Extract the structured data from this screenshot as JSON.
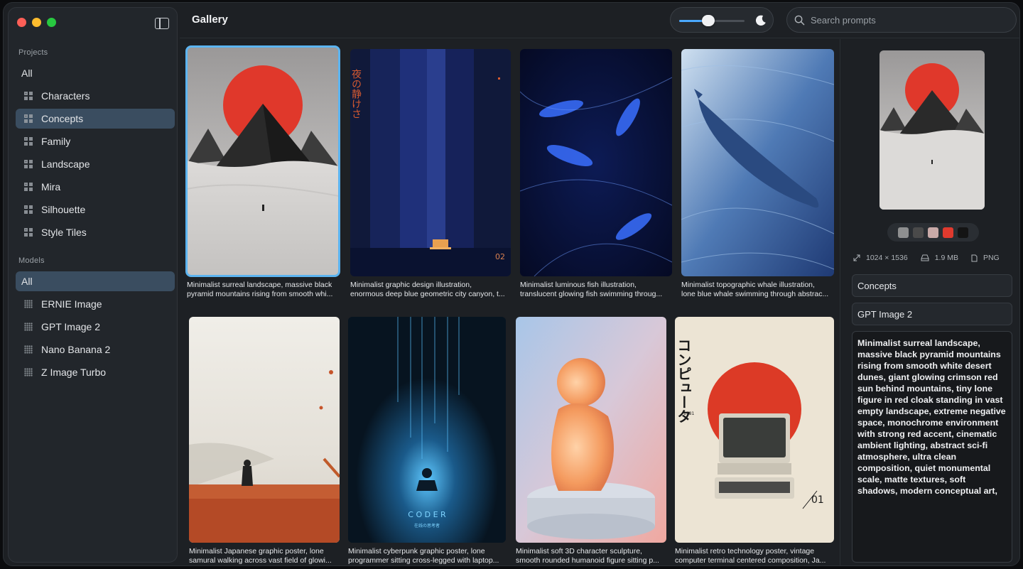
{
  "header": {
    "title": "Gallery",
    "zoom_value": 0.45,
    "search_placeholder": "Search prompts"
  },
  "sidebar": {
    "projects_label": "Projects",
    "projects": [
      {
        "label": "All",
        "icon": "none"
      },
      {
        "label": "Characters",
        "icon": "grid-icon"
      },
      {
        "label": "Concepts",
        "icon": "grid-icon",
        "active": true
      },
      {
        "label": "Family",
        "icon": "grid-icon"
      },
      {
        "label": "Landscape",
        "icon": "grid-icon"
      },
      {
        "label": "Mira",
        "icon": "grid-icon"
      },
      {
        "label": "Silhouette",
        "icon": "grid-icon"
      },
      {
        "label": "Style Tiles",
        "icon": "grid-icon"
      }
    ],
    "models_label": "Models",
    "models": [
      {
        "label": "All",
        "icon": "none",
        "active": true
      },
      {
        "label": "ERNIE Image",
        "icon": "dots-icon"
      },
      {
        "label": "GPT Image 2",
        "icon": "dots-icon"
      },
      {
        "label": "Nano Banana 2",
        "icon": "dots-icon"
      },
      {
        "label": "Z Image Turbo",
        "icon": "dots-icon"
      }
    ]
  },
  "gallery": {
    "items": [
      {
        "caption1": "Minimalist surreal landscape, massive black",
        "caption2": "pyramid mountains rising from smooth whi...",
        "selected": true
      },
      {
        "caption1": "Minimalist graphic design illustration,",
        "caption2": "enormous deep blue geometric city canyon, t..."
      },
      {
        "caption1": "Minimalist luminous fish illustration,",
        "caption2": "translucent glowing fish swimming throug..."
      },
      {
        "caption1": "Minimalist topographic whale illustration,",
        "caption2": "lone blue whale swimming through abstrac..."
      },
      {
        "caption1": "Minimalist Japanese graphic poster, lone",
        "caption2": "samural walking across vast field of glowi..."
      },
      {
        "caption1": "Minimalist cyberpunk graphic poster, lone",
        "caption2": "programmer sitting cross-legged with laptop..."
      },
      {
        "caption1": "Minimalist soft 3D character sculpture,",
        "caption2": "smooth rounded humanoid figure sitting p..."
      },
      {
        "caption1": "Minimalist retro technology poster, vintage",
        "caption2": "computer terminal centered composition, Ja..."
      }
    ],
    "poster_text": {
      "city_vertical": "夜の静けさ",
      "city_num": "02",
      "coder": "C O D E R",
      "coder_sub": "在线の思考者",
      "computer_vertical": "コンピュータ",
      "computer_year": "1981",
      "computer_num": "01"
    }
  },
  "inspector": {
    "swatches": [
      "#8e8f90",
      "#4a4a4a",
      "#c9aaa8",
      "#e03a2e",
      "#141414"
    ],
    "dimensions": "1024 × 1536",
    "size": "1.9 MB",
    "format": "PNG",
    "project": "Concepts",
    "model": "GPT Image 2",
    "prompt": "Minimalist surreal landscape, massive black pyramid mountains rising from smooth white desert dunes, giant glowing crimson red sun behind mountains, tiny lone figure in red cloak standing in vast empty landscape, extreme negative space, monochrome environment with strong red accent, cinematic ambient lighting, abstract sci-fi atmosphere, ultra clean composition, quiet monumental scale, matte textures, soft shadows, modern conceptual art,"
  }
}
